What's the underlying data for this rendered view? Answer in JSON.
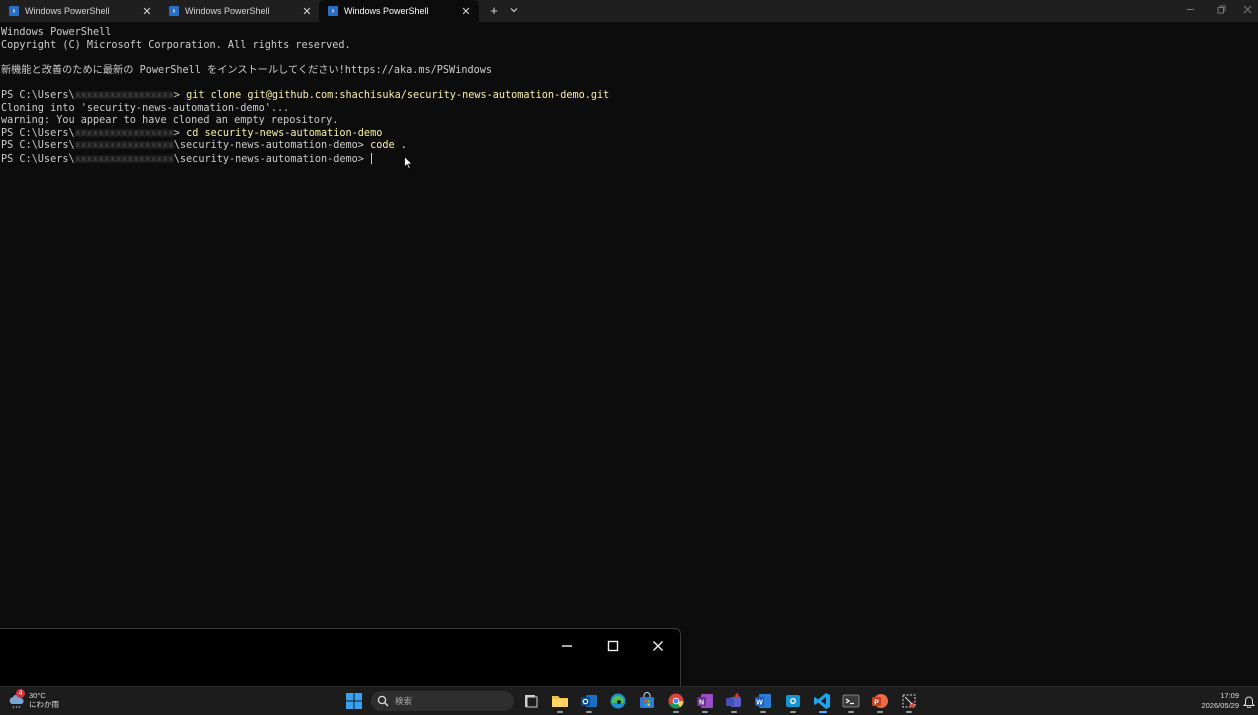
{
  "tabs": [
    {
      "title": "Windows PowerShell",
      "active": false
    },
    {
      "title": "Windows PowerShell",
      "active": false
    },
    {
      "title": "Windows PowerShell",
      "active": true
    }
  ],
  "tabbar": {
    "new_tab_label": "+",
    "dropdown_label": "⌄"
  },
  "terminal": {
    "line1": "Windows PowerShell",
    "line2": "Copyright (C) Microsoft Corporation. All rights reserved.",
    "line3": "新機能と改善のために最新の PowerShell をインストールしてください!https://aka.ms/PSWindows",
    "prompt_prefix": "PS C:\\Users\\",
    "blurred_user": "xxxxxxxxxxxxxxxxx",
    "prompt1_suffix": "> ",
    "cmd1": "git clone git@github.com:shachisuka/security-news-automation-demo.git",
    "out1": "Cloning into 'security-news-automation-demo'...",
    "out2": "warning: You appear to have cloned an empty repository.",
    "cmd2": "cd security-news-automation-demo",
    "prompt3_suffix": "\\security-news-automation-demo> ",
    "cmd3": "code .",
    "prompt4_suffix": "\\security-news-automation-demo> "
  },
  "taskbar": {
    "weather_temp": "30°C",
    "weather_desc": "にわか雨",
    "weather_badge": "4",
    "search_placeholder": "検索",
    "time": "17:09",
    "date": "2026/05/29"
  },
  "colors": {
    "terminal_bg": "#0c0c0c",
    "command_text": "#f9f1a5",
    "tab_icon": "#2b6cc4"
  }
}
